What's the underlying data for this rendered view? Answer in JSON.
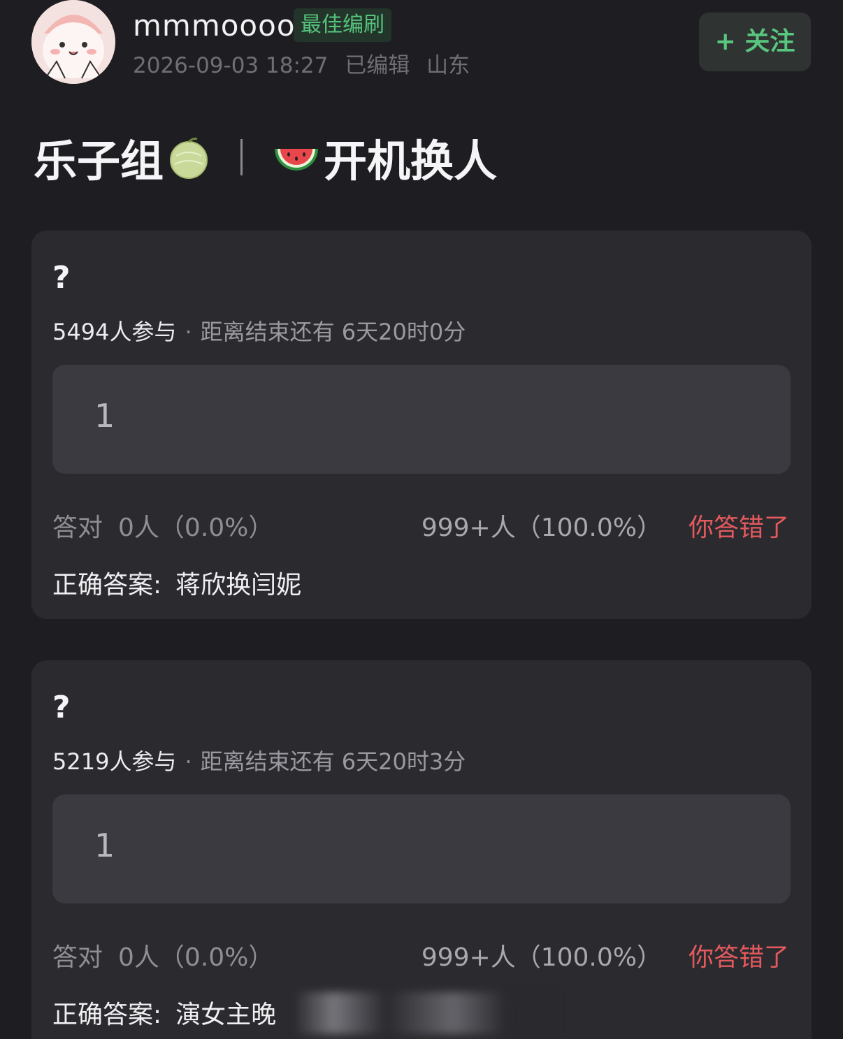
{
  "header": {
    "username": "mmmoooo",
    "badge": "最佳编刷",
    "date": "2026-09-03 18:27",
    "edited": "已编辑",
    "location": "山东",
    "follow_label": "+ 关注"
  },
  "post": {
    "title_left": "乐子组",
    "title_right": "开机换人",
    "emoji_left": "melon-icon",
    "emoji_right": "watermelon-icon"
  },
  "quizzes": [
    {
      "question": "?",
      "participants": "5494人参与",
      "separator": "·",
      "remaining": "距离结束还有 6天20时0分",
      "option": "1",
      "correct_label": "答对",
      "correct_value": "0人（0.0%）",
      "option_result": "999+人（100.0%）",
      "status": "你答错了",
      "answer_label": "正确答案:",
      "answer_value": "蒋欣换闫妮"
    },
    {
      "question": "?",
      "participants": "5219人参与",
      "separator": "·",
      "remaining": "距离结束还有 6天20时3分",
      "option": "1",
      "correct_label": "答对",
      "correct_value": "0人（0.0%）",
      "option_result": "999+人（100.0%）",
      "status": "你答错了",
      "answer_label": "正确答案:",
      "answer_value": "演女主晚"
    }
  ],
  "colors": {
    "background": "#1e1e22",
    "card": "#2a2a2f",
    "accent_green": "#59c67f",
    "wrong_red": "#e25a5e"
  }
}
